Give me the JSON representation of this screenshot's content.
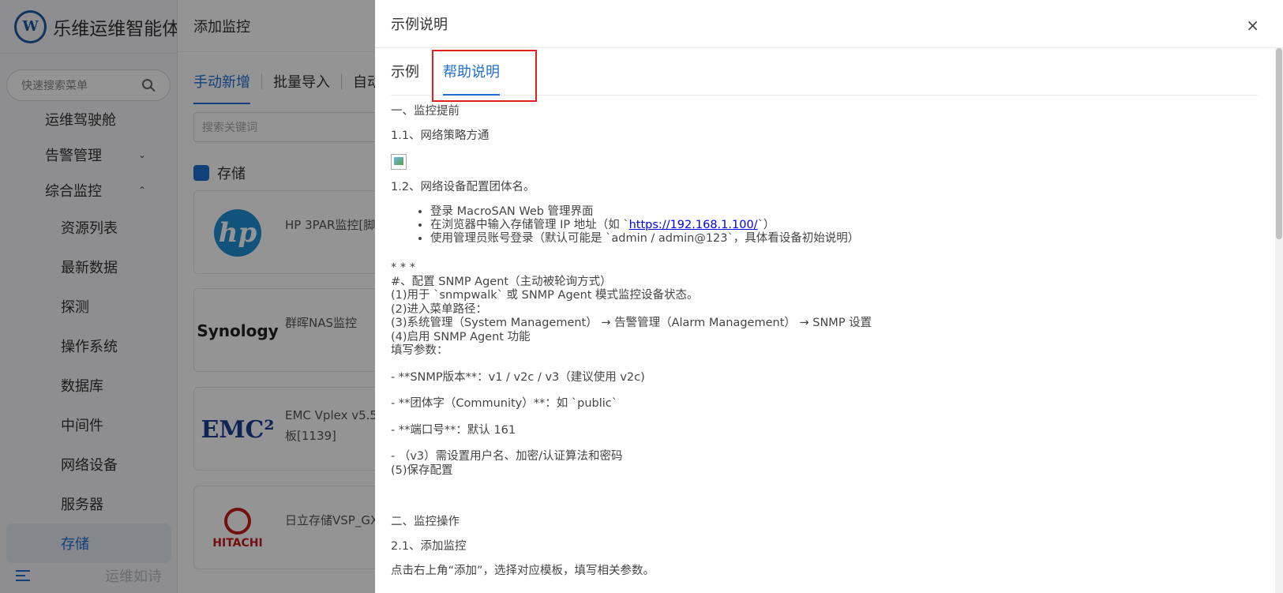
{
  "sidebar": {
    "brand": "乐维运维智能体",
    "search_placeholder": "快速搜索菜单",
    "items": [
      {
        "label": "运维驾驶舱"
      },
      {
        "label": "告警管理"
      },
      {
        "label": "综合监控"
      },
      {
        "label": "资源列表"
      },
      {
        "label": "最新数据"
      },
      {
        "label": "探测"
      },
      {
        "label": "操作系统"
      },
      {
        "label": "数据库"
      },
      {
        "label": "中间件"
      },
      {
        "label": "网络设备"
      },
      {
        "label": "服务器"
      },
      {
        "label": "存储"
      }
    ],
    "footer": "运维如诗"
  },
  "panel": {
    "title": "添加监控",
    "tabs": [
      "手动新增",
      "批量导入",
      "自动"
    ],
    "keyword_placeholder": "搜索关键词",
    "section": "存储",
    "cards": [
      {
        "logo": "hp",
        "name": "HP 3PAR监控[脚"
      },
      {
        "logo": "Synology",
        "name": "群晖NAS监控"
      },
      {
        "logo": "EMC²",
        "name": "EMC Vplex v5.5 板[1139]"
      },
      {
        "logo": "HITACHI",
        "name": "日立存储VSP_GX"
      }
    ]
  },
  "drawer": {
    "title": "示例说明",
    "close": "×",
    "tabs": [
      "示例",
      "帮助说明"
    ],
    "h1": "一、监控提前",
    "h1_1": "1.1、网络策略方通",
    "h1_2": "1.2、网络设备配置团体名。",
    "bullets": {
      "b1": "登录 MacroSAN Web 管理界面",
      "b2_pre": "在浏览器中输入存储管理 IP 地址（如 `",
      "b2_link": "https://192.168.1.100/",
      "b2_post": "`）",
      "b3": "使用管理员账号登录（默认可能是 `admin / admin@123`，具体看设备初始说明）"
    },
    "config": {
      "l1": "* * *",
      "l2": "#、配置 SNMP Agent（主动被轮询方式）",
      "l3": "(1)用于 `snmpwalk` 或 SNMP Agent 模式监控设备状态。",
      "l4": "(2)进入菜单路径：",
      "l5": "(3)系统管理（System Management） → 告警管理（Alarm Management） → SNMP 设置",
      "l6": "(4)启用 SNMP Agent 功能",
      "l7": "填写参数：",
      "p1": "- **SNMP版本**：v1 / v2c / v3（建议使用 v2c)",
      "p2": "- **团体字（Community）**：如 `public`",
      "p3": "- **端口号**：默认 161",
      "p4": "- （v3）需设置用户名、加密/认证算法和密码",
      "p5": "(5)保存配置"
    },
    "h2": "二、监控操作",
    "h2_1": "2.1、添加监控",
    "h2_1_text": "点击右上角“添加”，选择对应模板，填写相关参数。"
  }
}
